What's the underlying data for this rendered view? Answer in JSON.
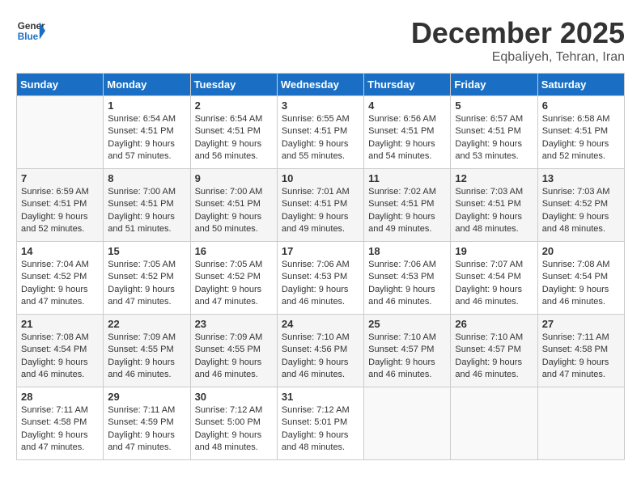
{
  "header": {
    "logo_line1": "General",
    "logo_line2": "Blue",
    "month_year": "December 2025",
    "location": "Eqbaliyeh, Tehran, Iran"
  },
  "days_of_week": [
    "Sunday",
    "Monday",
    "Tuesday",
    "Wednesday",
    "Thursday",
    "Friday",
    "Saturday"
  ],
  "weeks": [
    [
      {
        "day": "",
        "sunrise": "",
        "sunset": "",
        "daylight": ""
      },
      {
        "day": "1",
        "sunrise": "Sunrise: 6:54 AM",
        "sunset": "Sunset: 4:51 PM",
        "daylight": "Daylight: 9 hours and 57 minutes."
      },
      {
        "day": "2",
        "sunrise": "Sunrise: 6:54 AM",
        "sunset": "Sunset: 4:51 PM",
        "daylight": "Daylight: 9 hours and 56 minutes."
      },
      {
        "day": "3",
        "sunrise": "Sunrise: 6:55 AM",
        "sunset": "Sunset: 4:51 PM",
        "daylight": "Daylight: 9 hours and 55 minutes."
      },
      {
        "day": "4",
        "sunrise": "Sunrise: 6:56 AM",
        "sunset": "Sunset: 4:51 PM",
        "daylight": "Daylight: 9 hours and 54 minutes."
      },
      {
        "day": "5",
        "sunrise": "Sunrise: 6:57 AM",
        "sunset": "Sunset: 4:51 PM",
        "daylight": "Daylight: 9 hours and 53 minutes."
      },
      {
        "day": "6",
        "sunrise": "Sunrise: 6:58 AM",
        "sunset": "Sunset: 4:51 PM",
        "daylight": "Daylight: 9 hours and 52 minutes."
      }
    ],
    [
      {
        "day": "7",
        "sunrise": "Sunrise: 6:59 AM",
        "sunset": "Sunset: 4:51 PM",
        "daylight": "Daylight: 9 hours and 52 minutes."
      },
      {
        "day": "8",
        "sunrise": "Sunrise: 7:00 AM",
        "sunset": "Sunset: 4:51 PM",
        "daylight": "Daylight: 9 hours and 51 minutes."
      },
      {
        "day": "9",
        "sunrise": "Sunrise: 7:00 AM",
        "sunset": "Sunset: 4:51 PM",
        "daylight": "Daylight: 9 hours and 50 minutes."
      },
      {
        "day": "10",
        "sunrise": "Sunrise: 7:01 AM",
        "sunset": "Sunset: 4:51 PM",
        "daylight": "Daylight: 9 hours and 49 minutes."
      },
      {
        "day": "11",
        "sunrise": "Sunrise: 7:02 AM",
        "sunset": "Sunset: 4:51 PM",
        "daylight": "Daylight: 9 hours and 49 minutes."
      },
      {
        "day": "12",
        "sunrise": "Sunrise: 7:03 AM",
        "sunset": "Sunset: 4:51 PM",
        "daylight": "Daylight: 9 hours and 48 minutes."
      },
      {
        "day": "13",
        "sunrise": "Sunrise: 7:03 AM",
        "sunset": "Sunset: 4:52 PM",
        "daylight": "Daylight: 9 hours and 48 minutes."
      }
    ],
    [
      {
        "day": "14",
        "sunrise": "Sunrise: 7:04 AM",
        "sunset": "Sunset: 4:52 PM",
        "daylight": "Daylight: 9 hours and 47 minutes."
      },
      {
        "day": "15",
        "sunrise": "Sunrise: 7:05 AM",
        "sunset": "Sunset: 4:52 PM",
        "daylight": "Daylight: 9 hours and 47 minutes."
      },
      {
        "day": "16",
        "sunrise": "Sunrise: 7:05 AM",
        "sunset": "Sunset: 4:52 PM",
        "daylight": "Daylight: 9 hours and 47 minutes."
      },
      {
        "day": "17",
        "sunrise": "Sunrise: 7:06 AM",
        "sunset": "Sunset: 4:53 PM",
        "daylight": "Daylight: 9 hours and 46 minutes."
      },
      {
        "day": "18",
        "sunrise": "Sunrise: 7:06 AM",
        "sunset": "Sunset: 4:53 PM",
        "daylight": "Daylight: 9 hours and 46 minutes."
      },
      {
        "day": "19",
        "sunrise": "Sunrise: 7:07 AM",
        "sunset": "Sunset: 4:54 PM",
        "daylight": "Daylight: 9 hours and 46 minutes."
      },
      {
        "day": "20",
        "sunrise": "Sunrise: 7:08 AM",
        "sunset": "Sunset: 4:54 PM",
        "daylight": "Daylight: 9 hours and 46 minutes."
      }
    ],
    [
      {
        "day": "21",
        "sunrise": "Sunrise: 7:08 AM",
        "sunset": "Sunset: 4:54 PM",
        "daylight": "Daylight: 9 hours and 46 minutes."
      },
      {
        "day": "22",
        "sunrise": "Sunrise: 7:09 AM",
        "sunset": "Sunset: 4:55 PM",
        "daylight": "Daylight: 9 hours and 46 minutes."
      },
      {
        "day": "23",
        "sunrise": "Sunrise: 7:09 AM",
        "sunset": "Sunset: 4:55 PM",
        "daylight": "Daylight: 9 hours and 46 minutes."
      },
      {
        "day": "24",
        "sunrise": "Sunrise: 7:10 AM",
        "sunset": "Sunset: 4:56 PM",
        "daylight": "Daylight: 9 hours and 46 minutes."
      },
      {
        "day": "25",
        "sunrise": "Sunrise: 7:10 AM",
        "sunset": "Sunset: 4:57 PM",
        "daylight": "Daylight: 9 hours and 46 minutes."
      },
      {
        "day": "26",
        "sunrise": "Sunrise: 7:10 AM",
        "sunset": "Sunset: 4:57 PM",
        "daylight": "Daylight: 9 hours and 46 minutes."
      },
      {
        "day": "27",
        "sunrise": "Sunrise: 7:11 AM",
        "sunset": "Sunset: 4:58 PM",
        "daylight": "Daylight: 9 hours and 47 minutes."
      }
    ],
    [
      {
        "day": "28",
        "sunrise": "Sunrise: 7:11 AM",
        "sunset": "Sunset: 4:58 PM",
        "daylight": "Daylight: 9 hours and 47 minutes."
      },
      {
        "day": "29",
        "sunrise": "Sunrise: 7:11 AM",
        "sunset": "Sunset: 4:59 PM",
        "daylight": "Daylight: 9 hours and 47 minutes."
      },
      {
        "day": "30",
        "sunrise": "Sunrise: 7:12 AM",
        "sunset": "Sunset: 5:00 PM",
        "daylight": "Daylight: 9 hours and 48 minutes."
      },
      {
        "day": "31",
        "sunrise": "Sunrise: 7:12 AM",
        "sunset": "Sunset: 5:01 PM",
        "daylight": "Daylight: 9 hours and 48 minutes."
      },
      {
        "day": "",
        "sunrise": "",
        "sunset": "",
        "daylight": ""
      },
      {
        "day": "",
        "sunrise": "",
        "sunset": "",
        "daylight": ""
      },
      {
        "day": "",
        "sunrise": "",
        "sunset": "",
        "daylight": ""
      }
    ]
  ]
}
